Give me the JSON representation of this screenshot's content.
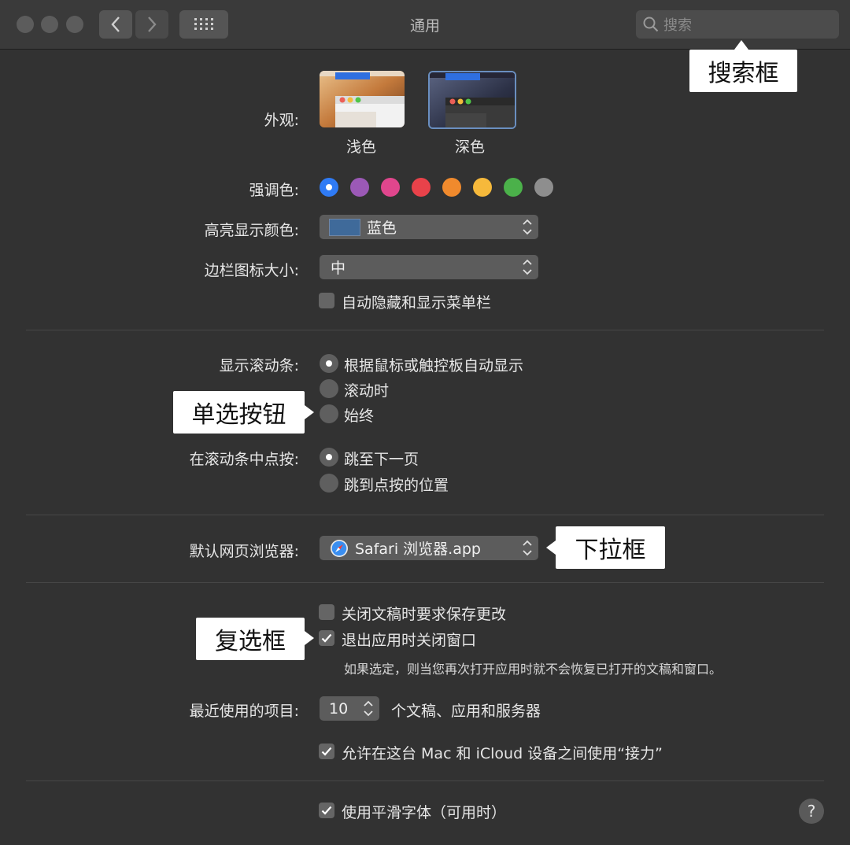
{
  "window": {
    "title": "通用",
    "search_placeholder": "搜索"
  },
  "appearance": {
    "label": "外观:",
    "options": [
      "浅色",
      "深色"
    ],
    "selected": "深色"
  },
  "accent": {
    "label": "强调色:",
    "colors": [
      "#2f7bf5",
      "#9b59b6",
      "#e0468d",
      "#e9424a",
      "#f08a2d",
      "#f6b93b",
      "#4bb14a",
      "#8e8e8e"
    ],
    "selected_index": 0
  },
  "highlight": {
    "label": "高亮显示颜色:",
    "value": "蓝色",
    "swatch_color": "#3f6a9a"
  },
  "sidebar_icon": {
    "label": "边栏图标大小:",
    "value": "中"
  },
  "menubar": {
    "label": "自动隐藏和显示菜单栏",
    "checked": false
  },
  "scrollbars": {
    "label": "显示滚动条:",
    "options": [
      "根据鼠标或触控板自动显示",
      "滚动时",
      "始终"
    ],
    "selected_index": 0
  },
  "click_scroll": {
    "label": "在滚动条中点按:",
    "options": [
      "跳至下一页",
      "跳到点按的位置"
    ],
    "selected_index": 0
  },
  "browser": {
    "label": "默认网页浏览器:",
    "value": "Safari 浏览器.app"
  },
  "docs": {
    "ask_save": "关闭文稿时要求保存更改",
    "ask_save_checked": false,
    "close_windows": "退出应用时关闭窗口",
    "close_windows_checked": true,
    "note": "如果选定，则当您再次打开应用时就不会恢复已打开的文稿和窗口。"
  },
  "recent": {
    "label": "最近使用的项目:",
    "value": "10",
    "suffix": "个文稿、应用和服务器"
  },
  "handoff": {
    "label": "允许在这台 Mac 和 iCloud 设备之间使用“接力”",
    "checked": true
  },
  "fonts": {
    "label": "使用平滑字体（可用时）",
    "checked": true
  },
  "help_label": "?",
  "callouts": {
    "search": "搜索框",
    "radio": "单选按钮",
    "dropdown": "下拉框",
    "checkbox": "复选框"
  }
}
